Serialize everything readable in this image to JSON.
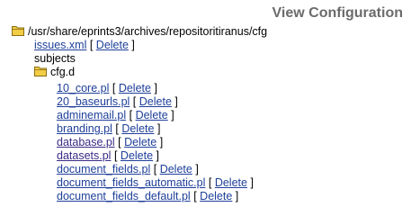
{
  "header": {
    "title": "View Configuration"
  },
  "tree": {
    "root_path": "/usr/share/eprints3/archives/repositoritiranus/cfg",
    "delete_label": "Delete",
    "bracket_open": "[",
    "bracket_close": "]",
    "root_files": [
      {
        "name": "issues.xml"
      }
    ],
    "subjects_label": "subjects",
    "cfg_d_folder": "cfg.d",
    "cfg_d_files": [
      {
        "name": "10_core.pl"
      },
      {
        "name": "20_baseurls.pl"
      },
      {
        "name": "adminemail.pl"
      },
      {
        "name": "branding.pl"
      },
      {
        "name": "database.pl"
      },
      {
        "name": "datasets.pl"
      },
      {
        "name": "document_fields.pl"
      },
      {
        "name": "document_fields_automatic.pl"
      },
      {
        "name": "document_fields_default.pl"
      }
    ]
  },
  "icons": {
    "folder": "folder-icon",
    "folder_color": "#f2cd45"
  }
}
